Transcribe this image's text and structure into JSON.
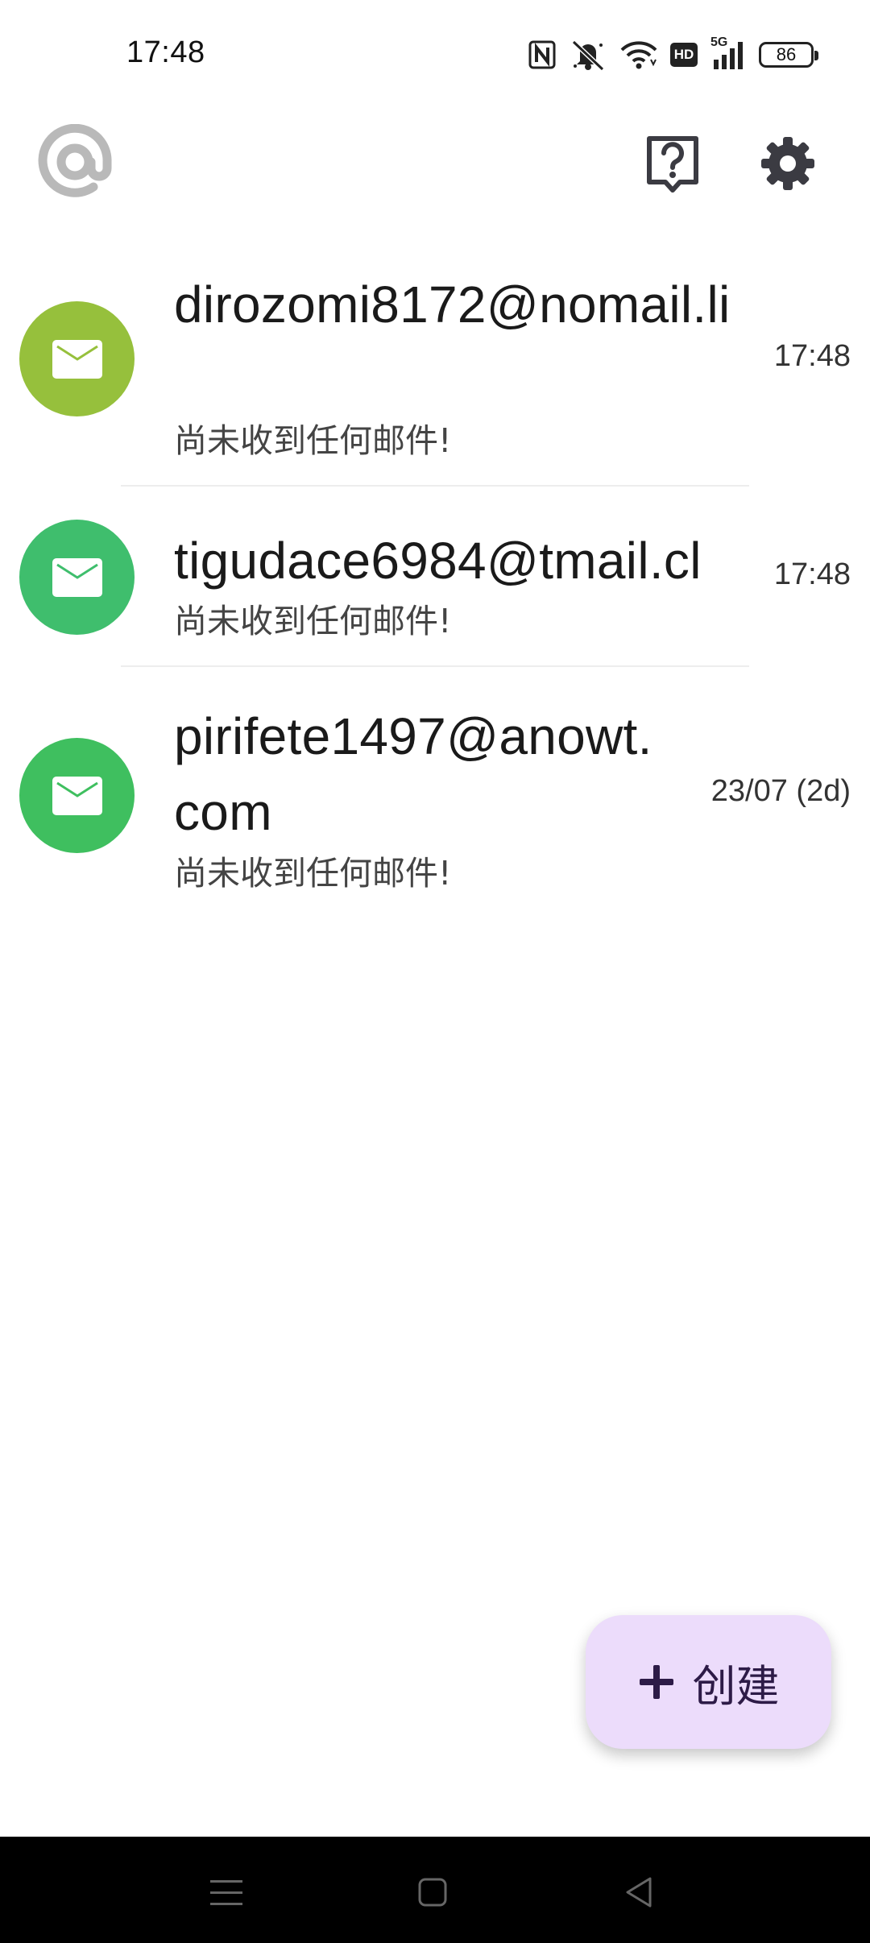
{
  "status_bar": {
    "time": "17:48",
    "battery_level": "86",
    "network_label": "5G",
    "hd_label": "HD",
    "icons": [
      "nfc-icon",
      "mute-icon",
      "wifi-icon",
      "hd-icon",
      "signal-icon",
      "battery-icon"
    ]
  },
  "app_bar": {
    "logo_icon": "at-sign-icon",
    "help_icon": "help-icon",
    "settings_icon": "gear-icon"
  },
  "inbox": {
    "items": [
      {
        "address": "dirozomi8172@nomail.li",
        "subtitle": "尚未收到任何邮件!",
        "time": "17:48",
        "avatar_color": "#96c03c"
      },
      {
        "address": "tigudace6984@tmail.cl",
        "subtitle": "尚未收到任何邮件!",
        "time": "17:48",
        "avatar_color": "#3fbe6d"
      },
      {
        "address": "pirifete1497@anowt.com",
        "subtitle": "尚未收到任何邮件!",
        "time": "23/07 (2d)",
        "avatar_color": "#3fbf5f"
      }
    ]
  },
  "fab": {
    "label": "创建",
    "icon": "plus-icon",
    "color": "#ecdcfb"
  },
  "nav_bar": {
    "icons": [
      "menu-icon",
      "home-icon",
      "back-icon"
    ]
  }
}
